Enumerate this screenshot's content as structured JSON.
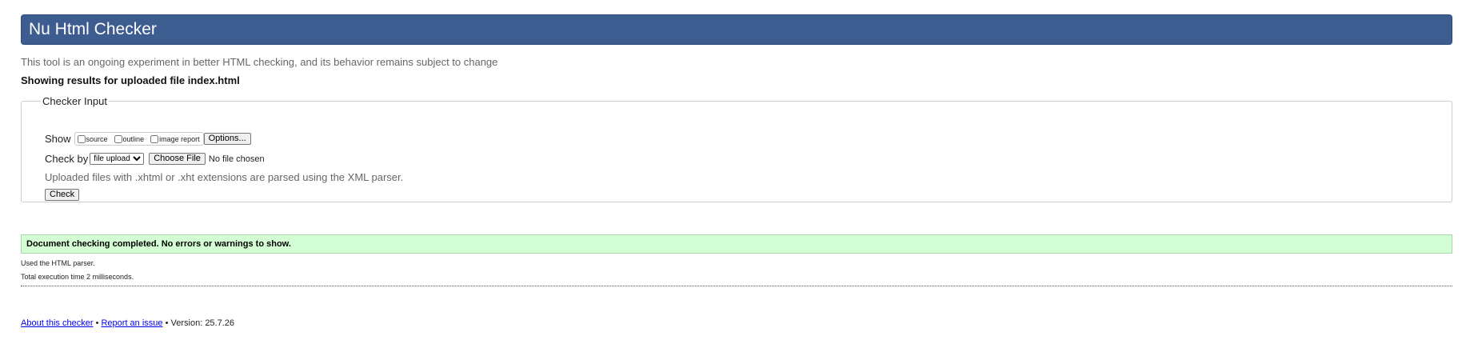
{
  "header": {
    "title": "Nu Html Checker"
  },
  "intro": "This tool is an ongoing experiment in better HTML checking, and its behavior remains subject to change",
  "results_heading": "Showing results for uploaded file index.html",
  "checker_input": {
    "legend": "Checker Input",
    "show_label": "Show",
    "show_options": [
      {
        "label": "source",
        "checked": false
      },
      {
        "label": "outline",
        "checked": false
      },
      {
        "label": "image report",
        "checked": false
      }
    ],
    "options_button": "Options...",
    "check_by_label": "Check by",
    "check_by_selected": "file upload",
    "choose_file_button": "Choose File",
    "no_file_text": "No file chosen",
    "note": "Uploaded files with .xhtml or .xht extensions are parsed using the XML parser.",
    "check_button": "Check"
  },
  "result": {
    "success_message": "Document checking completed. No errors or warnings to show.",
    "parser_note": "Used the HTML parser.",
    "execution_time": "Total execution time 2 milliseconds."
  },
  "footer": {
    "about_link": "About this checker",
    "separator": "•",
    "report_link": "Report an issue",
    "version": "Version: 25.7.26"
  },
  "colors": {
    "header_bg": "#3d5c8f",
    "success_bg": "#d4ffd4",
    "link": "#0000ee"
  }
}
